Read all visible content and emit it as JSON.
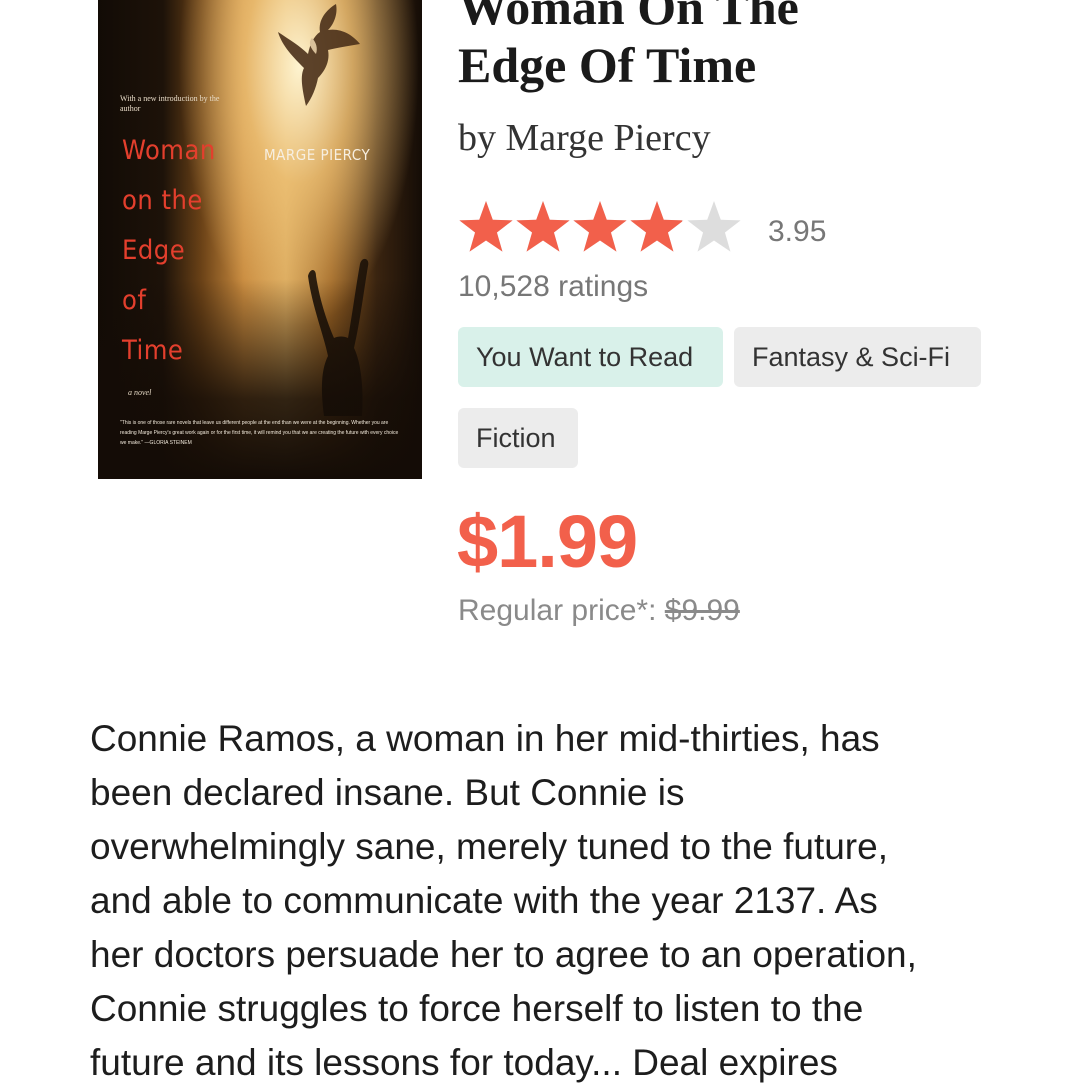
{
  "book": {
    "title": "Woman On The\nEdge Of Time",
    "author_line": "by Marge Piercy",
    "rating": 3.95,
    "rating_text": "3.95",
    "ratings_count": "10,528 ratings",
    "star_color_filled": "#f2604b",
    "star_color_empty": "#dddddd",
    "want_to_read_label": "You Want to Read",
    "tags": [
      "Fantasy & Sci-Fi",
      "Fiction"
    ],
    "price": "$1.99",
    "regular_price_label": "Regular price*: ",
    "regular_price": "$9.99"
  },
  "cover": {
    "intro": "With a new introduction by the author",
    "title": "Woman\non the\nEdge\nof\nTime",
    "author": "MARGE PIERCY",
    "subtitle": "a novel",
    "blurb": "\"This is one of those rare novels that leave us different people at the end than we were at the beginning. Whether you are reading Marge Piercy's great work again or for the first time, it will remind you that we are creating the future with every choice we make.\" —GLORIA STEINEM"
  },
  "description": [
    "Connie Ramos, a woman in her mid-thirties, has",
    "been declared insane. But Connie is",
    "overwhelmingly sane, merely tuned to the future,",
    "and able to communicate with the year 2137. As",
    "her doctors persuade her to agree to an operation,",
    "Connie struggles to force herself to listen to the",
    "future and its lessons for today... Deal expires"
  ]
}
